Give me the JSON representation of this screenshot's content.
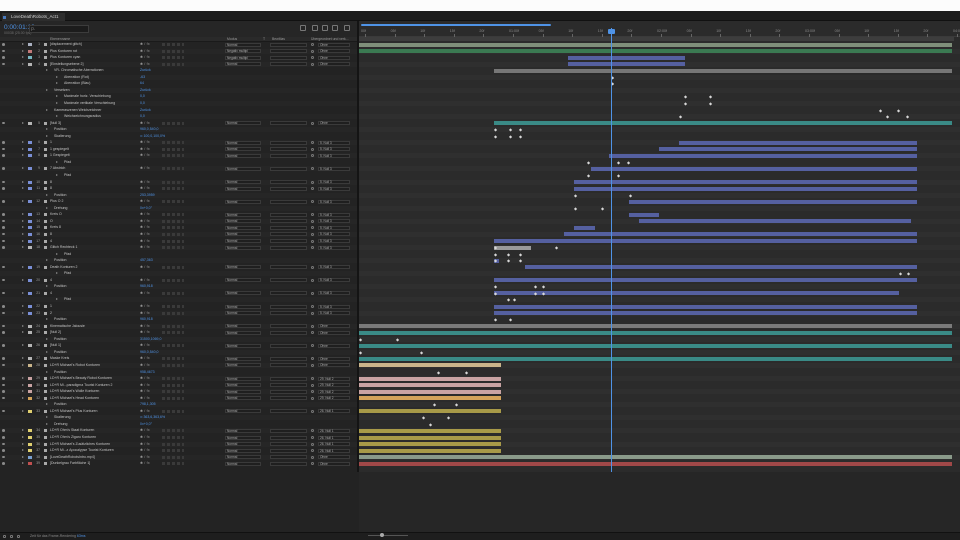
{
  "tab": {
    "title": "LoveDeathRobots_Act1"
  },
  "header": {
    "timecode": "0:00:01:13",
    "fps": "00038 (25.00 fps)",
    "search_placeholder": "ρ."
  },
  "columns": {
    "layer_name": "Ebenenname",
    "mode": "Modus",
    "trkmat": "T",
    "track_matte": "BewMas",
    "parent": "Übergeordnet und verk..."
  },
  "ruler": {
    "labels": [
      "00f",
      "05f",
      "10f",
      "15f",
      "20f",
      "01:00f",
      "05f",
      "10f",
      "15f",
      "20f",
      "02:00f",
      "05f",
      "10f",
      "15f",
      "20f",
      "03:00f",
      "05f",
      "10f",
      "15f",
      "20f",
      "04:00f"
    ]
  },
  "status": {
    "text": "Zeit für das Frame-Rendering",
    "value": "63ms"
  },
  "layers": [
    {
      "num": "1",
      "name": "[displacement glitch]",
      "label": "#aab1c2",
      "mode": "Normal",
      "parent": "Ohne",
      "indent": 0
    },
    {
      "num": "2",
      "name": "Plus Konturen rot",
      "label": "#c37a7a",
      "mode": "Negativ multipl",
      "parent": "Ohne",
      "indent": 0
    },
    {
      "num": "3",
      "name": "Plus Konturen cyan",
      "label": "#7ab8c3",
      "mode": "Negativ multipl",
      "parent": "Ohne",
      "indent": 0
    },
    {
      "num": "4",
      "name": "[Einstellungsebene 2]",
      "label": "#b5b5b5",
      "mode": "Normal",
      "parent": "Ohne",
      "indent": 0
    },
    {
      "name": "VR- Chromatische Aberrationen",
      "val": "Zurück",
      "indent": 2
    },
    {
      "name": "Aberration (Rot)",
      "val": "-63",
      "indent": 3
    },
    {
      "name": "Aberration (Blau)",
      "val": "64",
      "indent": 3
    },
    {
      "name": "Versetzen",
      "val": "Zurück",
      "indent": 2
    },
    {
      "name": "Maximale horiz. Verschiebung",
      "val": "0,0",
      "indent": 3
    },
    {
      "name": "Maximale vertikale Verschiebung",
      "val": "0,0",
      "indent": 3
    },
    {
      "name": "Kameraszenen Weichzeichner",
      "val": "Zurück",
      "indent": 2
    },
    {
      "name": "Weichzeichnungsradius",
      "val": "0,0",
      "indent": 3
    },
    {
      "num": "5",
      "name": "[Null 3]",
      "label": "#b5b5b5",
      "mode": "Normal",
      "parent": "Ohne",
      "indent": 0
    },
    {
      "name": "Position",
      "val": "960,0,540,0",
      "indent": 2
    },
    {
      "name": "Skalierung",
      "val": "∞ 100,0,100,0%",
      "indent": 2
    },
    {
      "num": "6",
      "name": "1",
      "label": "#7a8fd6",
      "mode": "Normal",
      "parent": "5. Null 3",
      "indent": 0
    },
    {
      "num": "7",
      "name": "1 gespiegelt",
      "label": "#7a8fd6",
      "mode": "Normal",
      "parent": "5. Null 3",
      "indent": 0
    },
    {
      "num": "8",
      "name": "1 Gespiegelt",
      "label": "#7a8fd6",
      "mode": "Normal",
      "parent": "5. Null 3",
      "indent": 0
    },
    {
      "name": "Pfad",
      "indent": 3
    },
    {
      "num": "9",
      "name": "7 Abstrich",
      "label": "#7a8fd6",
      "mode": "Normal",
      "parent": "5. Null 3",
      "indent": 0
    },
    {
      "name": "Pfad",
      "indent": 3
    },
    {
      "num": "10",
      "name": "8",
      "label": "#7a8fd6",
      "mode": "Normal",
      "parent": "5. Null 3",
      "indent": 0
    },
    {
      "num": "11",
      "name": "8",
      "label": "#7a8fd6",
      "mode": "Normal",
      "parent": "5. Null 3",
      "indent": 0
    },
    {
      "name": "Position",
      "val": "253,3959",
      "indent": 2
    },
    {
      "num": "12",
      "name": "Plus O 2",
      "label": "#7a8fd6",
      "mode": "Normal",
      "parent": "5. Null 3",
      "indent": 0
    },
    {
      "name": "Drehung",
      "val": "0x+0,0°",
      "indent": 2
    },
    {
      "num": "13",
      "name": "Kreis O",
      "label": "#7a8fd6",
      "mode": "Normal",
      "parent": "5. Null 3",
      "indent": 0
    },
    {
      "num": "14",
      "name": "O",
      "label": "#7a8fd6",
      "mode": "Normal",
      "parent": "5. Null 3",
      "indent": 0
    },
    {
      "num": "15",
      "name": "Kreis 8",
      "label": "#7a8fd6",
      "mode": "Normal",
      "parent": "5. Null 3",
      "indent": 0
    },
    {
      "num": "16",
      "name": "8",
      "label": "#7a8fd6",
      "mode": "Normal",
      "parent": "5. Null 3",
      "indent": 0
    },
    {
      "num": "17",
      "name": "4",
      "label": "#7a8fd6",
      "mode": "Normal",
      "parent": "5. Null 3",
      "indent": 0
    },
    {
      "num": "18",
      "name": "Glitch Rechteck 1",
      "label": "#b5b5b5",
      "mode": "Normal",
      "parent": "5. Null 3",
      "indent": 0
    },
    {
      "name": "Pfad",
      "indent": 3
    },
    {
      "name": "Position",
      "val": "457,363",
      "indent": 2
    },
    {
      "num": "19",
      "name": "Death Konturen 2",
      "label": "#7a8fd6",
      "mode": "Normal",
      "parent": "5. Null 3",
      "indent": 0
    },
    {
      "name": "Pfad",
      "indent": 3
    },
    {
      "num": "20",
      "name": "4",
      "label": "#7a8fd6",
      "mode": "Normal",
      "parent": "5. Null 3",
      "indent": 0
    },
    {
      "name": "Position",
      "val": "960,918",
      "indent": 2
    },
    {
      "num": "21",
      "name": "4",
      "label": "#7a8fd6",
      "mode": "Normal",
      "parent": "5. Null 3",
      "indent": 0
    },
    {
      "name": "Pfad",
      "indent": 3
    },
    {
      "num": "22",
      "name": "1",
      "label": "#7a8fd6",
      "mode": "Normal",
      "parent": "5. Null 3",
      "indent": 0
    },
    {
      "num": "23",
      "name": "2",
      "label": "#7a8fd6",
      "mode": "Normal",
      "parent": "5. Null 3",
      "indent": 0
    },
    {
      "name": "Position",
      "val": "960,918",
      "indent": 2
    },
    {
      "num": "24",
      "name": "Kinematische Jalousie",
      "label": "#b5b5b5",
      "mode": "Normal",
      "parent": "Ohne",
      "indent": 0
    },
    {
      "num": "25",
      "name": "[Null 2]",
      "label": "#b5b5b5",
      "mode": "Normal",
      "parent": "Ohne",
      "indent": 0
    },
    {
      "name": "Position",
      "val": "31500,1069,0",
      "indent": 2
    },
    {
      "num": "26",
      "name": "[Null 1]",
      "label": "#b5b5b5",
      "mode": "Normal",
      "parent": "Ohne",
      "indent": 0
    },
    {
      "name": "Position",
      "val": "960,0,540,0",
      "indent": 2
    },
    {
      "num": "27",
      "name": "Maske Kreis",
      "label": "#b5b5b5",
      "mode": "Normal",
      "parent": "Ohne",
      "indent": 0
    },
    {
      "num": "28",
      "name": "LD+R Michael's Robot Konturen",
      "label": "#c9b48a",
      "mode": "Normal",
      "parent": "Ohne",
      "indent": 0
    },
    {
      "name": "Position",
      "val": "958,4673",
      "indent": 2
    },
    {
      "num": "29",
      "name": "LD+R Michael's Beauty Robot Konturen",
      "label": "#c9a3a3",
      "mode": "Normal",
      "parent": "29. Null 2",
      "indent": 0
    },
    {
      "num": "30",
      "name": "LD+R Mi...paradigma Tourist Konturen 2",
      "label": "#c9a3a3",
      "mode": "Normal",
      "parent": "29. Null 2",
      "indent": 0
    },
    {
      "num": "31",
      "name": "LD+R Michael's Wolle Konturen",
      "label": "#c9a3a3",
      "mode": "Normal",
      "parent": "29. Null 2",
      "indent": 0
    },
    {
      "num": "32",
      "name": "LD+R Michael's Head Konturen",
      "label": "#d4a35a",
      "mode": "Normal",
      "parent": "29. Null 2",
      "indent": 0
    },
    {
      "name": "Position",
      "val": "798,1,305",
      "indent": 2
    },
    {
      "num": "33",
      "name": "LD+R Michael's Plus Konturen",
      "label": "#e0d070",
      "mode": "Normal",
      "parent": "26. Null 1",
      "indent": 0
    },
    {
      "name": "Skalierung",
      "val": "∞ 363,6,363,6%",
      "indent": 2
    },
    {
      "name": "Drehung",
      "val": "0x+0,0°",
      "indent": 2
    },
    {
      "num": "34",
      "name": "LD+R Ohm's Staat Konturen",
      "label": "#e0d070",
      "mode": "Normal",
      "parent": "26. Null 1",
      "indent": 0
    },
    {
      "num": "35",
      "name": "LD+R Ohm's Zigaro Konturen",
      "label": "#e0d070",
      "mode": "Normal",
      "parent": "26. Null 1",
      "indent": 0
    },
    {
      "num": "36",
      "name": "LD+R Michael's Zusätzliches Konturen",
      "label": "#e0d070",
      "mode": "Normal",
      "parent": "26. Null 1",
      "indent": 0
    },
    {
      "num": "37",
      "name": "LD+R Mi...ε Apocalypse Tourist Konturen",
      "label": "#e0d070",
      "mode": "Normal",
      "parent": "26. Null 1",
      "indent": 0
    },
    {
      "num": "38",
      "name": "[LoveDeathRobotsIntro.mp4]",
      "label": "#7aa0d0",
      "mode": "Normal",
      "parent": "Ohne",
      "indent": 0
    },
    {
      "num": "39",
      "name": "[Dunkelgrau Farbfläche 1]",
      "label": "#c05050",
      "mode": "Normal",
      "parent": "Ohne",
      "indent": 0
    }
  ]
}
